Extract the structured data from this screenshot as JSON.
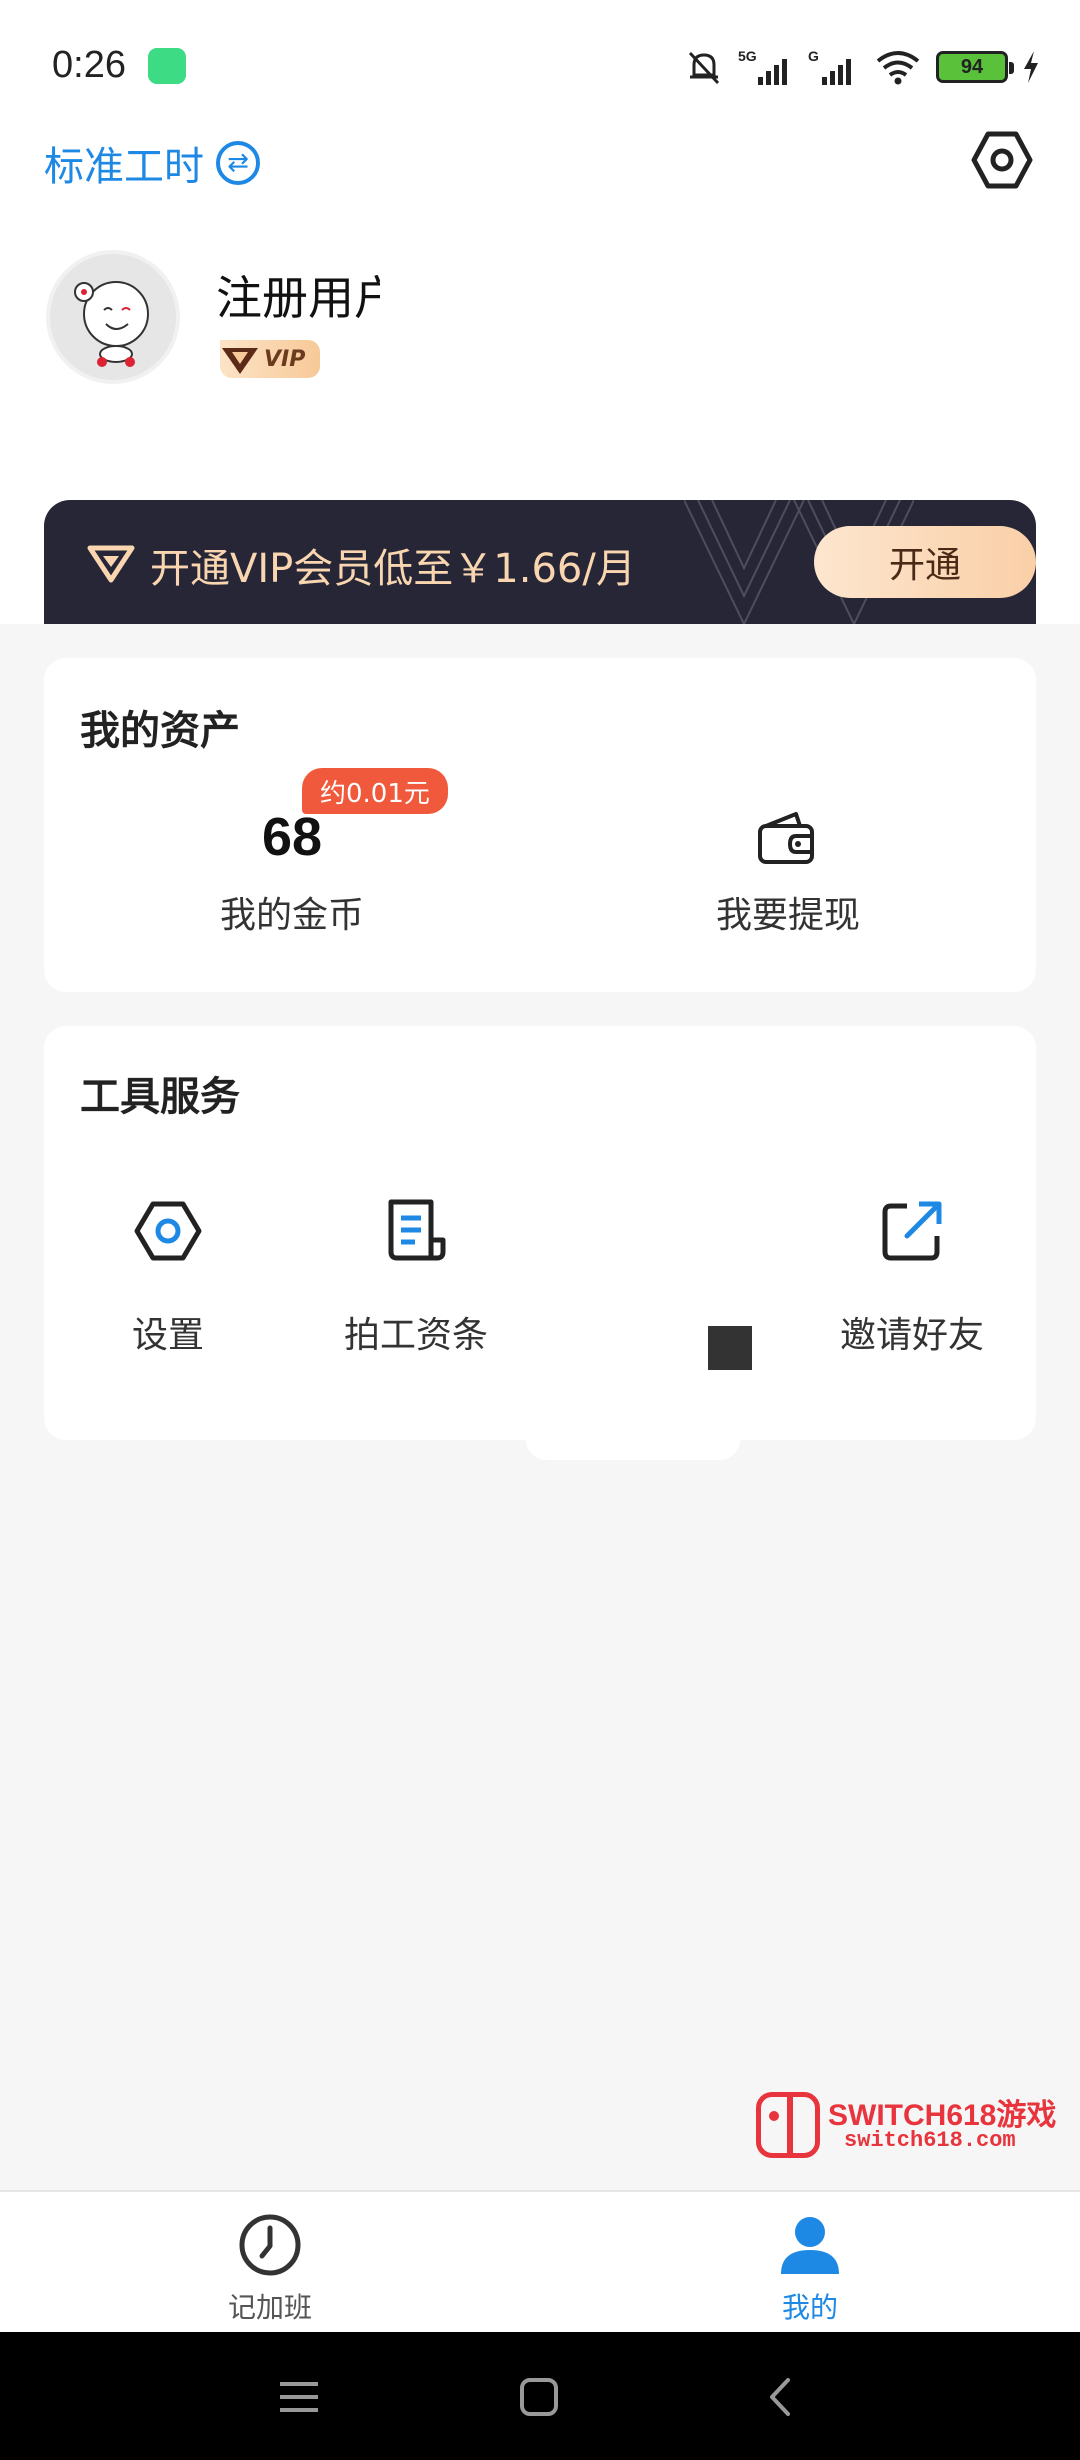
{
  "status_bar": {
    "time": "0:26",
    "battery": "94",
    "network": "5G"
  },
  "header": {
    "mode_label": "标准工时",
    "swap_symbol": "⇄"
  },
  "profile": {
    "username": "注册用户",
    "vip_tag": "VIP"
  },
  "vip_banner": {
    "text": "开通VIP会员低至￥1.66/月",
    "button_label": "开通"
  },
  "assets": {
    "title": "我的资产",
    "coin_tag": "约0.01元",
    "coins": "68",
    "coins_label": "我的金币",
    "withdraw_label": "我要提现"
  },
  "tools": {
    "title": "工具服务",
    "items": [
      {
        "label": "设置",
        "icon": "settings-icon"
      },
      {
        "label": "拍工资条",
        "icon": "payslip-icon"
      },
      {
        "label": "",
        "icon": "blank-icon"
      },
      {
        "label": "邀请好友",
        "icon": "share-icon"
      }
    ]
  },
  "watermark": {
    "title": "SWITCH618游戏",
    "url": "switch618.com"
  },
  "bottom_nav": {
    "items": [
      {
        "label": "记加班",
        "icon": "clock-icon",
        "active": false
      },
      {
        "label": "我的",
        "icon": "person-icon",
        "active": true
      }
    ]
  },
  "colors": {
    "accent": "#1e88e5",
    "vip_dark": "#262637",
    "tag_red": "#f0593b"
  }
}
